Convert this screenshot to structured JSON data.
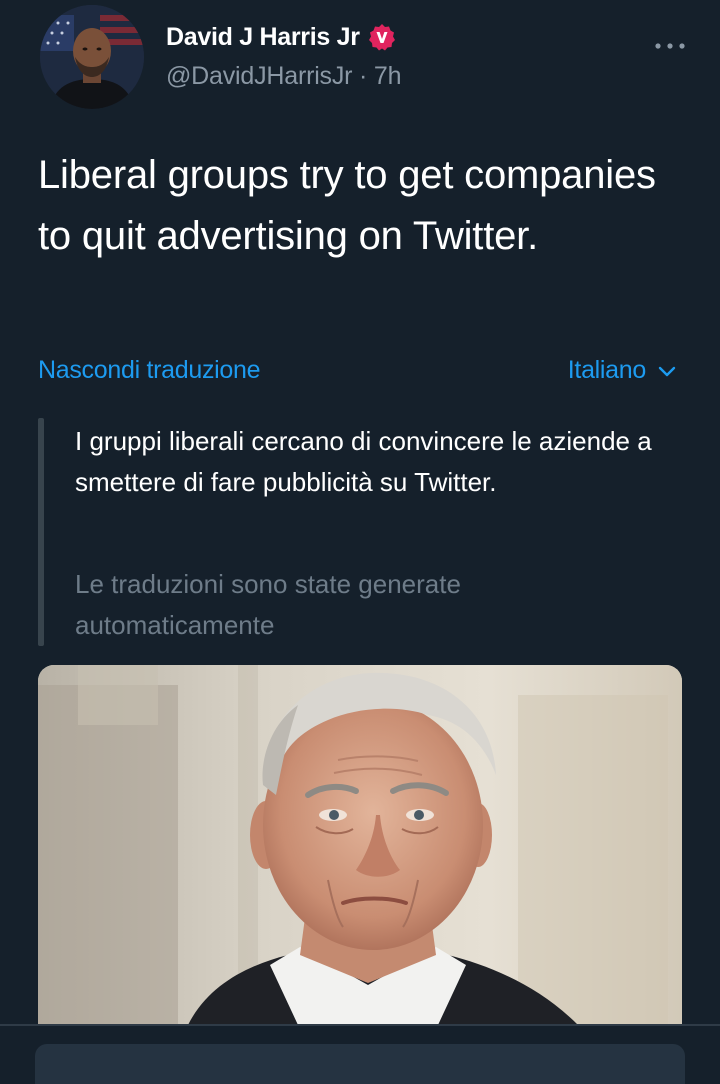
{
  "author": {
    "display_name": "David J Harris Jr",
    "handle_time": "@DavidJHarrisJr · 7h",
    "badge_letter": "V",
    "badge_color": "#e0245e",
    "avatar_icon": "profile-photo"
  },
  "menu": {
    "icon": "more-horizontal-icon"
  },
  "tweet": {
    "text": "Liberal groups try to get companies to quit advertising on Twitter."
  },
  "translation": {
    "hide_label": "Nascondi traduzione",
    "language_label": "Italiano",
    "translated_text": "I gruppi liberali cercano di convincere le aziende a smettere di fare pubblicità su Twitter.",
    "note": "Le traduzioni sono state generate automaticamente"
  },
  "colors": {
    "background": "#15202b",
    "link": "#1d9bf0",
    "secondary_text": "#8b98a5",
    "note_text": "#6e7c89"
  }
}
